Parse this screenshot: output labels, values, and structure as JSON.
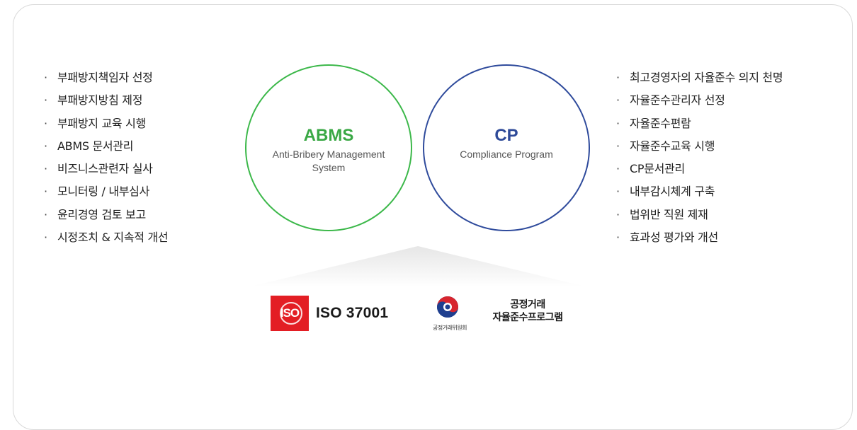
{
  "left_list": [
    "부패방지책임자 선정",
    "부패방지방침 제정",
    "부패방지 교육 시행",
    "ABMS 문서관리",
    "비즈니스관련자 실사",
    "모니터링 / 내부심사",
    "윤리경영 검토 보고",
    "시정조치 & 지속적 개선"
  ],
  "right_list": [
    "최고경영자의 자율준수 의지 천명",
    "자율준수관리자 선정",
    "자율준수편람",
    "자율준수교육 시행",
    "CP문서관리",
    "내부감시체계 구축",
    "법위반 직원 제재",
    "효과성 평가와 개선"
  ],
  "abms": {
    "title": "ABMS",
    "subtitle": "Anti-Bribery Management System",
    "color": "#3cb84a"
  },
  "cp": {
    "title": "CP",
    "subtitle": "Compliance Program",
    "color": "#2f4b9c"
  },
  "logos": {
    "iso": {
      "mark": "ISO",
      "label": "ISO 37001",
      "color": "#e31e24"
    },
    "kftc": {
      "agency": "공정거래위원회",
      "name_line1": "공정거래",
      "name_line2": "자율준수프로그램"
    }
  }
}
